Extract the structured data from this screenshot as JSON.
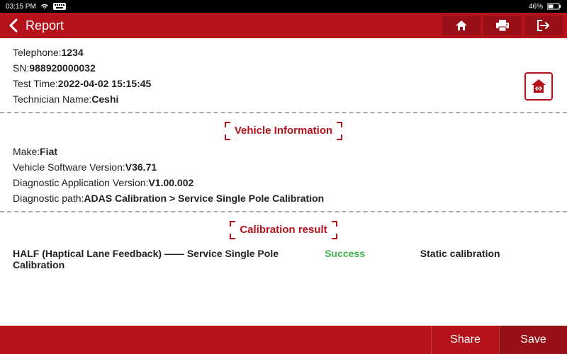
{
  "statusbar": {
    "time": "03:15 PM",
    "battery": "46%"
  },
  "appbar": {
    "title": "Report"
  },
  "top_info": {
    "telephone_label": "Telephone:",
    "telephone_value": "1234",
    "sn_label": "SN:",
    "sn_value": "988920000032",
    "test_time_label": "Test Time:",
    "test_time_value": "2022-04-02 15:15:45",
    "technician_label": "Technician Name:",
    "technician_value": "Ceshi"
  },
  "vehicle_section": {
    "title": "Vehicle Information",
    "make_label": "Make:",
    "make_value": "Fiat",
    "vsv_label": "Vehicle Software Version:",
    "vsv_value": "V36.71",
    "dav_label": "Diagnostic Application Version:",
    "dav_value": "V1.00.002",
    "path_label": "Diagnostic path:",
    "path_value": "ADAS Calibration > Service Single Pole Calibration"
  },
  "calibration_section": {
    "title": "Calibration result",
    "item_name": "HALF (Haptical Lane Feedback) —— Service Single Pole Calibration",
    "status": "Success",
    "type": "Static calibration"
  },
  "footer": {
    "share": "Share",
    "save": "Save"
  }
}
